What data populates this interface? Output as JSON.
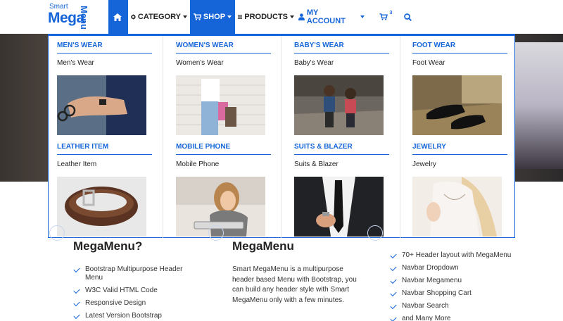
{
  "logo": {
    "smart": "Smart",
    "mega": "Mega",
    "menu": "Menu"
  },
  "nav": {
    "home_icon": "home-icon",
    "category": "CATEGORY",
    "shop": "SHOP",
    "products": "PRODUCTS",
    "account": "MY ACCOUNT",
    "cart_badge": "3",
    "search_icon": "search-icon"
  },
  "mega_menu": {
    "categories": [
      {
        "title": "MEN'S WEAR",
        "sub": "Men's Wear"
      },
      {
        "title": "WOMEN'S WEAR",
        "sub": "Women's Wear"
      },
      {
        "title": "BABY'S WEAR",
        "sub": "Baby's Wear"
      },
      {
        "title": "FOOT WEAR",
        "sub": "Foot Wear"
      },
      {
        "title": "LEATHER ITEM",
        "sub": "Leather Item"
      },
      {
        "title": "MOBILE PHONE",
        "sub": "Mobile Phone"
      },
      {
        "title": "SUITS & BLAZER",
        "sub": "Suits & Blazer"
      },
      {
        "title": "JEWELRY",
        "sub": "Jewelry"
      }
    ]
  },
  "lower": {
    "left_title": "MegaMenu?",
    "left_features": [
      "Bootstrap Multipurpose Header Menu",
      "W3C Valid HTML Code",
      "Responsive Design",
      "Latest Version Bootstrap"
    ],
    "center_title": "MegaMenu",
    "center_text": "Smart MegaMenu is a multipurpose header based Menu with Bootstrap, you can build any header style with Smart MegaMenu only with a few minutes.",
    "right_features": [
      "70+ Header layout with MegaMenu",
      "Navbar Dropdown",
      "Navbar Megamenu",
      "Navbar Shopping Cart",
      "Navbar Search",
      "and Many More"
    ]
  },
  "colors": {
    "brand": "#1565d8"
  }
}
